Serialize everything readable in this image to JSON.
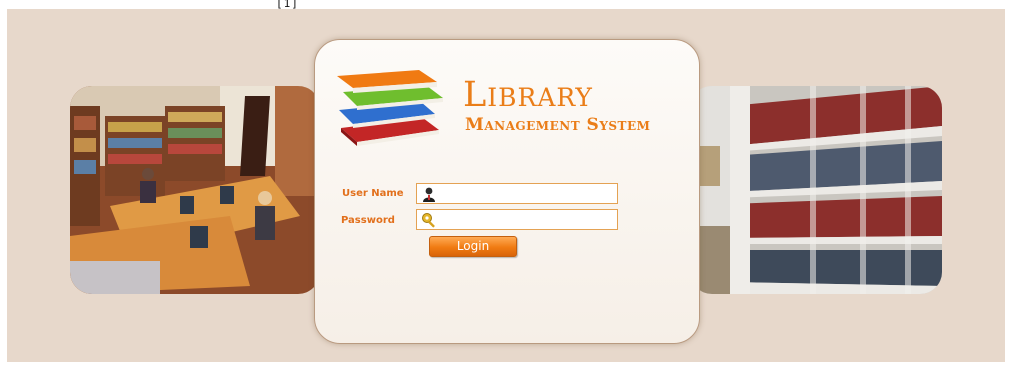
{
  "header": {
    "corner_mark": "[1]"
  },
  "logo": {
    "line1": "Library",
    "line2": "Management System"
  },
  "form": {
    "username_label": "User Name",
    "username_value": "",
    "password_label": "Password",
    "password_value": "",
    "login_label": "Login"
  },
  "icons": {
    "username": "user-icon",
    "password": "key-icon"
  },
  "colors": {
    "accent": "#ea7d18",
    "backdrop": "#e7d8cb",
    "panel": "#fbf7f2"
  }
}
